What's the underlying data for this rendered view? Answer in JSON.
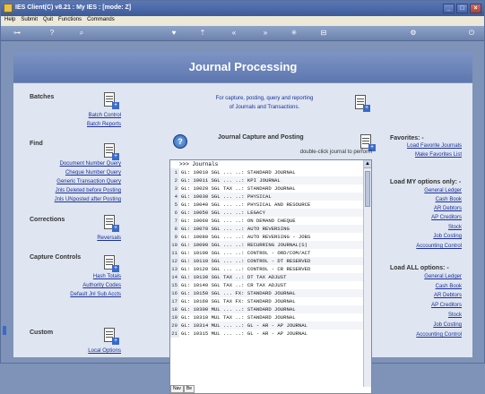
{
  "window": {
    "title": "IES Client(C) v8.21 : My IES :    [mode: Z]"
  },
  "menu": [
    "Help",
    "Submit",
    "Quit",
    "Functions",
    "Commands"
  ],
  "header": {
    "title": "Journal Processing"
  },
  "batches": {
    "title": "Batches",
    "links": [
      "Batch Control",
      "Batch Reports"
    ]
  },
  "find": {
    "title": "Find",
    "links": [
      "Document Number Query",
      "Cheque Number Query",
      "Generic Transaction Query",
      "Jnls Deleted before Posting",
      "Jnls UNposted after Posting"
    ]
  },
  "corrections": {
    "title": "Corrections",
    "links": [
      "Reversals"
    ]
  },
  "capture_controls": {
    "title": "Capture Controls",
    "links": [
      "Hash Totals",
      "Authority Codes",
      "Default Jnl Sub Accts"
    ]
  },
  "custom": {
    "title": "Custom",
    "links": [
      "Local Options"
    ]
  },
  "info": {
    "line1": "For capture, posting, query and reporting",
    "line2": "of Journals and Transactions."
  },
  "capture": {
    "title": "Journal Capture and Posting",
    "hint": "double-click journal to perform"
  },
  "journal_list": {
    "header": ">>> Journals",
    "rows": [
      {
        "n": "1",
        "t": "GL: 10010 SGL ... ..: STANDARD JOURNAL"
      },
      {
        "n": "2",
        "t": "GL: 10011 SGL ... ..: KPI JOURNAL"
      },
      {
        "n": "3",
        "t": "GL: 10020 SGL TAX ..: STANDARD JOURNAL"
      },
      {
        "n": "4",
        "t": "GL: 10030 SGL ... ..: PHYSICAL"
      },
      {
        "n": "5",
        "t": "GL: 10040 SGL ... ..: PHYSICAL AND RESOURCE"
      },
      {
        "n": "6",
        "t": "GL: 10050 SGL ... ..: LEGACY"
      },
      {
        "n": "7",
        "t": "GL: 10060 SGL ... ..: ON DEMAND CHEQUE"
      },
      {
        "n": "8",
        "t": "GL: 10070 SGL ... ..: AUTO REVERSING"
      },
      {
        "n": "9",
        "t": "GL: 10080 SGL ... ..: AUTO REVERSING - JOBS"
      },
      {
        "n": "10",
        "t": "GL: 10090 SGL ... ..: RECURRING JOURNAL(S)"
      },
      {
        "n": "11",
        "t": "GL: 10100 SGL ... ..: CONTROL - ORD/COM/ACT"
      },
      {
        "n": "12",
        "t": "GL: 10110 SGL ... ..: CONTROL - DT RESERVED"
      },
      {
        "n": "13",
        "t": "GL: 10120 SGL ... ..: CONTROL - CR RESERVED"
      },
      {
        "n": "14",
        "t": "GL: 10130 SGL TAX ..: DT TAX ADJUST"
      },
      {
        "n": "15",
        "t": "GL: 10140 SGL TAX ..: CR TAX ADJUST"
      },
      {
        "n": "16",
        "t": "GL: 10150 SGL ... FX: STANDARD JOURNAL"
      },
      {
        "n": "17",
        "t": "GL: 10160 SGL TAX FX: STANDARD JOURNAL"
      },
      {
        "n": "18",
        "t": "GL: 10300 MUL ... ..: STANDARD JOURNAL"
      },
      {
        "n": "19",
        "t": "GL: 10310 MUL TAX ..: STANDARD JOURNAL"
      },
      {
        "n": "20",
        "t": "GL: 10314 MUL ... ..: GL - AR - AP JOURNAL"
      },
      {
        "n": "21",
        "t": "GL: 10315 MUL ... ..: GL - AR - AP JOURNAL"
      }
    ],
    "tabs": [
      "Nav",
      "Be"
    ]
  },
  "favorites": {
    "title": "Favorites: -",
    "links": [
      "Load Favorite Journals",
      "Make Favorites List"
    ]
  },
  "my_options": {
    "title": "Load MY options only: -",
    "links": [
      "General Ledger",
      "Cash Book",
      "AR Debtors",
      "AP Creditors",
      "Stock",
      "Job Costing",
      "Accounting Control"
    ]
  },
  "all_options": {
    "title": "Load ALL options: -",
    "links": [
      "General Ledger",
      "Cash Book",
      "AR Debtors",
      "AP Creditors",
      "Stock",
      "Job Costing",
      "Accounting Control"
    ]
  }
}
